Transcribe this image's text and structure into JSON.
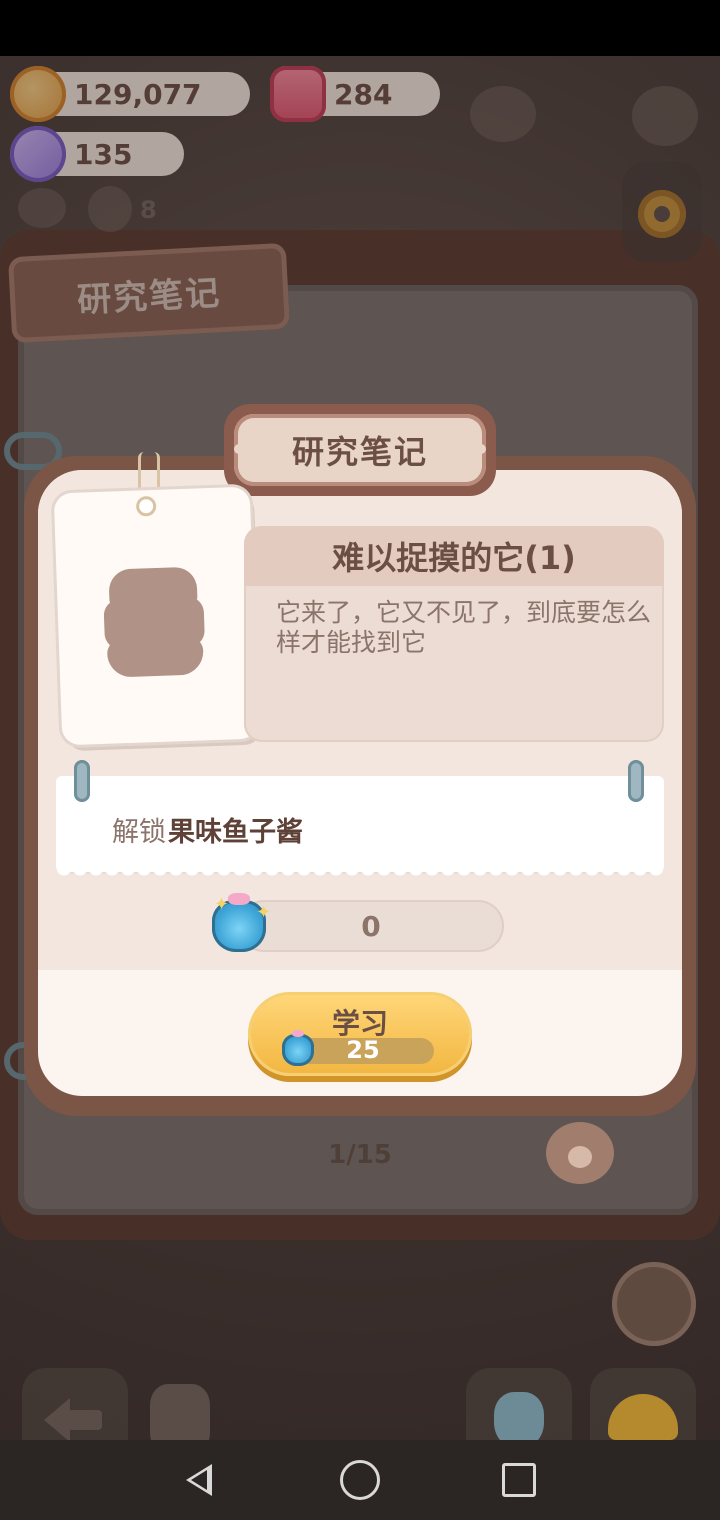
{
  "currencies": {
    "cookies": "129,077",
    "candles": "284",
    "tickets": "135"
  },
  "background": {
    "tab_title": "研究笔记",
    "counter": "8"
  },
  "dialog": {
    "title": "研究笔记",
    "note_title": "难以捉摸的它(1)",
    "note_desc": "它来了，它又不见了，到底要怎么样才能找到它",
    "unlock_prefix": "解锁",
    "unlock_item": "果味鱼子酱",
    "progress_value": "0",
    "progress_fraction": 0,
    "study_label": "学习",
    "study_cost": "25"
  },
  "pagination": {
    "page": "1/15"
  },
  "icons": {
    "cookie": "cookie-icon",
    "candle": "candle-icon",
    "ticket": "ticket-icon",
    "settings": "gear-icon",
    "gem_bag": "gem-bag-icon",
    "paw": "paw-icon",
    "back": "back-arrow-icon"
  },
  "colors": {
    "accent": "#f2b640",
    "frame": "#7b5647",
    "panel": "#fbf4ef"
  }
}
